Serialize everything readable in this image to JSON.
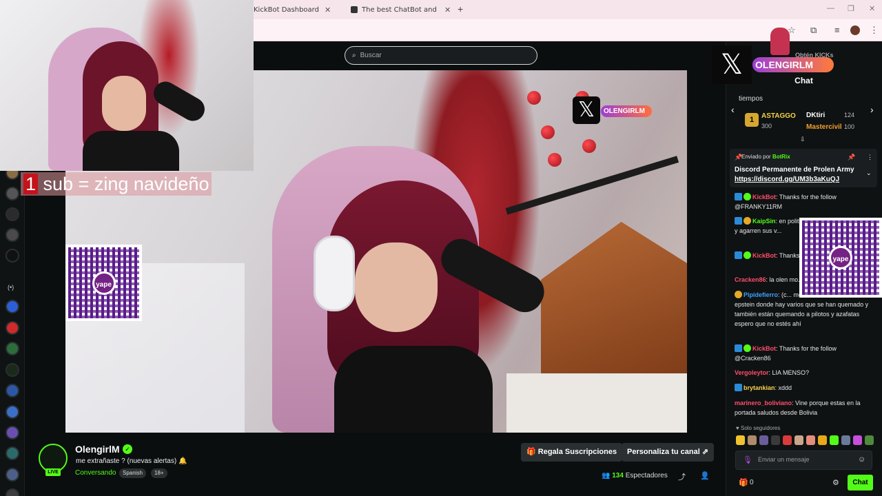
{
  "browser": {
    "tabs": [
      {
        "label": "KickBot Dashboard"
      },
      {
        "label": "The best ChatBot and Widgets"
      }
    ],
    "new_tab": "+"
  },
  "search": {
    "placeholder": "Buscar"
  },
  "stream": {
    "overlay_name": "OLENGIRLM",
    "sub_banner_num": "1",
    "sub_banner_text": " sub = zing navideño",
    "qr_label": "yape"
  },
  "channel": {
    "name": "OlengirlM",
    "live_label": "LIVE",
    "title": "me extrañaste ? (nuevas alertas) 🔔",
    "category": "Conversando",
    "tags": [
      "Spanish",
      "18+"
    ],
    "gift_button": "Regala Suscripciones",
    "customize_button": "Personaliza tu canal",
    "viewers_count": "134",
    "viewers_label": "Espectadores"
  },
  "chat": {
    "overlay_name": "OLENGIRLM",
    "kicks_button": "Obtén KICKs",
    "header": "Chat",
    "leaderboard_title": "tiempos",
    "leaderboard": [
      {
        "rank": "1",
        "name": "ASTAGGO",
        "value": "300",
        "color": "#f5d24a"
      },
      {
        "rank": "",
        "name": "DKtiri",
        "value": "124",
        "color": "#ffffff"
      },
      {
        "rank": "",
        "name": "Mastercivil",
        "value": "100",
        "color": "#f0a030"
      }
    ],
    "pinned": {
      "sent_by_label": "Enviado por",
      "sent_by_user": "BotRix",
      "title": "Discord Permanente de Prolen Army",
      "link": "https://discord.gg/UM3b3aKuQJ"
    },
    "messages": [
      {
        "user": "KickBot",
        "color": "#ff4d6a",
        "text": "Thanks for the follow @FRANKY11RM"
      },
      {
        "user": "KaipSin",
        "color": "#53fc18",
        "text": "en politica, 100 soles p... mitines y agarren sus v..."
      },
      {
        "user": "KickBot",
        "color": "#ff4d6a",
        "text": "Thanks... @CeParoPICHULon"
      },
      {
        "user": "Cracken86",
        "color": "#ff4d6a",
        "text": "la olen mo..."
      },
      {
        "user": "Pipidefierro",
        "color": "#3fa0ff",
        "text": "(c... mostraron la lista de epstein donde hay varios que se han quemado y también están quemando a pilotos y azafatas espero que no estés ahí"
      },
      {
        "user": "KickBot",
        "color": "#ff4d6a",
        "text": "Thanks for the follow @Cracken86"
      },
      {
        "user": "Vergoleytor",
        "color": "#ff4d6a",
        "text": "LIA MENSO?"
      },
      {
        "user": "brytankian",
        "color": "#f5d24a",
        "text": "xddd"
      },
      {
        "user": "marinero_boliviano",
        "color": "#ff4d6a",
        "text": "Vine porque estas en la portada saludos desde Bolivia"
      }
    ],
    "followers_only": "Solo seguidores",
    "input_placeholder": "Enviar un mensaje",
    "gift_count": "0",
    "send_button": "Chat"
  },
  "colors": {
    "accent": "#53fc18",
    "background": "#0b0e0f",
    "panel": "#0f1213"
  }
}
